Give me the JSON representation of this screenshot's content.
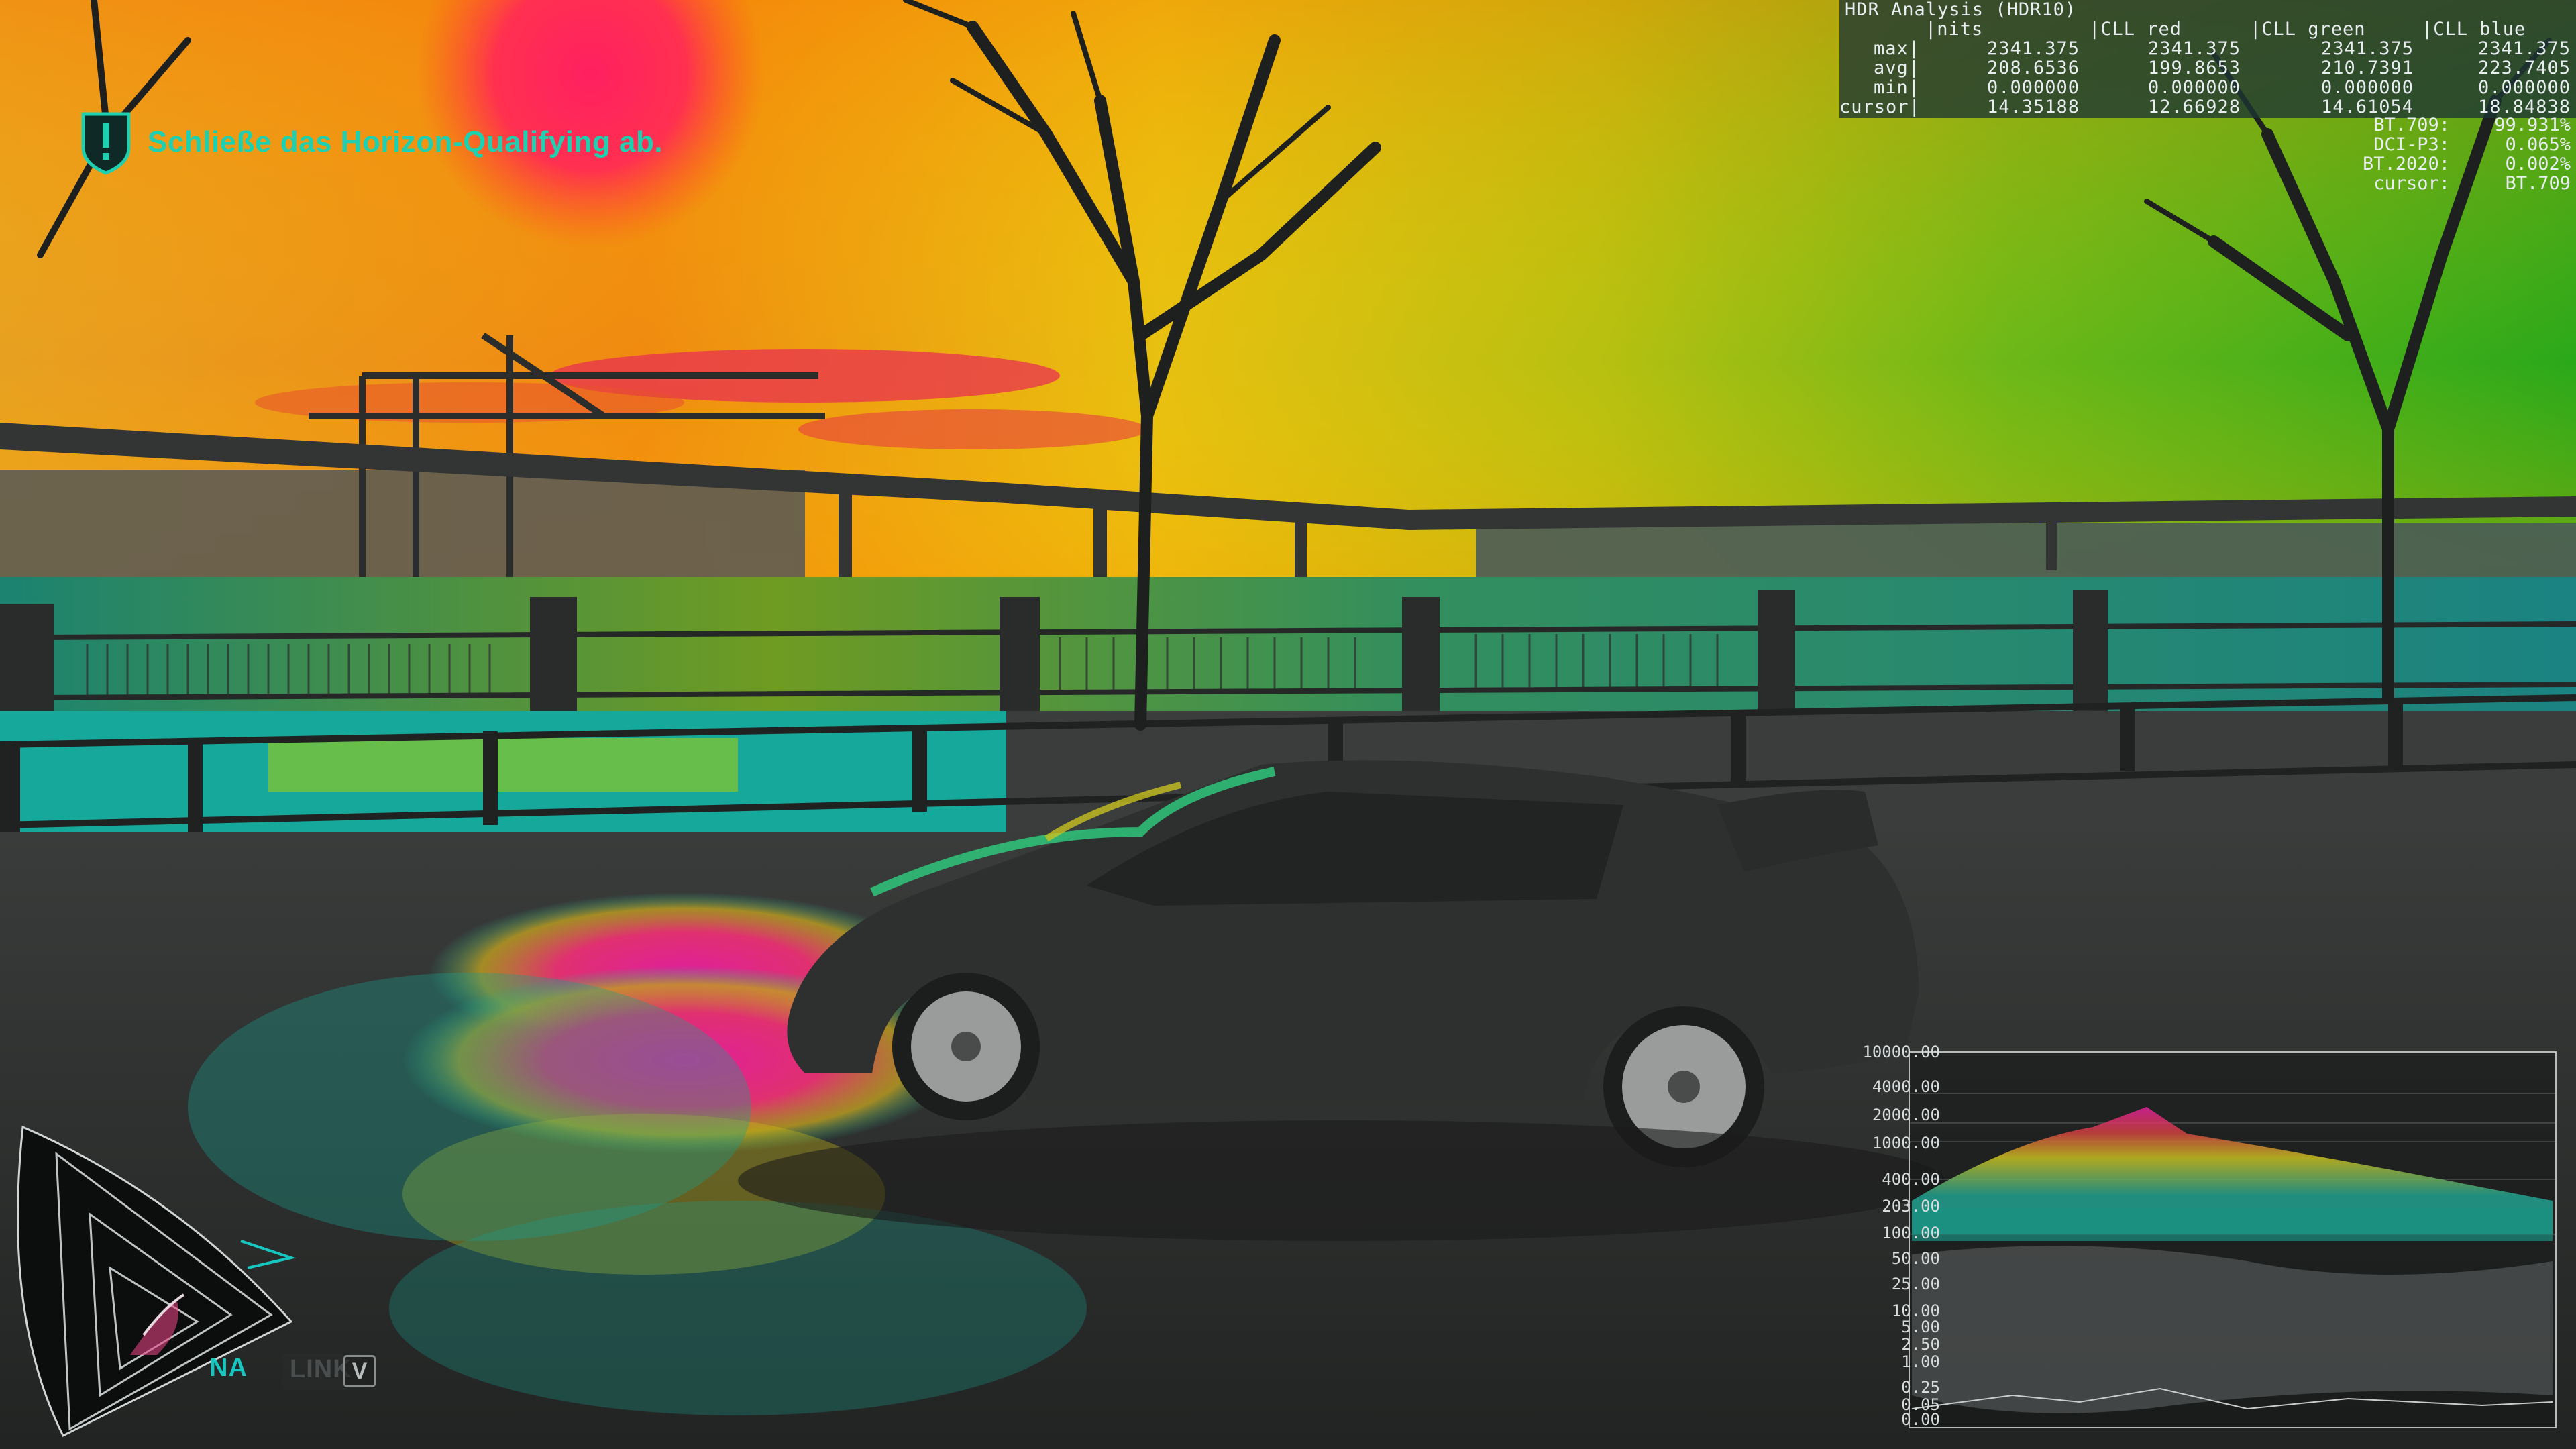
{
  "objective": {
    "text": "Schließe das Horizon-Qualifying ab.",
    "icon": "shield-exclamation-icon"
  },
  "hdr_analysis": {
    "title": "HDR Analysis (HDR10)",
    "headers": [
      "nits",
      "CLL red",
      "CLL green",
      "CLL blue"
    ],
    "rows": [
      {
        "label": "max",
        "values": [
          "2341.375",
          "2341.375",
          "2341.375",
          "2341.375"
        ]
      },
      {
        "label": "avg",
        "values": [
          "208.6536",
          "199.8653",
          "210.7391",
          "223.7405"
        ]
      },
      {
        "label": "min",
        "values": [
          "0.000000",
          "0.000000",
          "0.000000",
          "0.000000"
        ]
      },
      {
        "label": "cursor",
        "values": [
          "14.35188",
          "12.66928",
          "14.61054",
          "18.84838"
        ]
      }
    ],
    "gamut": [
      {
        "label": "BT.709:",
        "value": "99.931%"
      },
      {
        "label": "DCI-P3:",
        "value": "0.065%"
      },
      {
        "label": "BT.2020:",
        "value": "0.002%"
      },
      {
        "label": "cursor:",
        "value": "BT.709"
      }
    ]
  },
  "histogram": {
    "scale_labels": [
      "10000.00",
      "4000.00",
      "2000.00",
      "1000.00",
      "400.00",
      "203.00",
      "100.00",
      "50.00",
      "25.00",
      "10.00",
      "5.00",
      "2.50",
      "1.00",
      "0.25",
      "0.05",
      "0.00"
    ]
  },
  "hud": {
    "tag_na": "NA",
    "tag_link": "LINK",
    "key": "V"
  },
  "colors": {
    "objective_text": "#1fd0b0",
    "hud_accent": "#16c7c0",
    "panel_bg": "#1c3432"
  }
}
